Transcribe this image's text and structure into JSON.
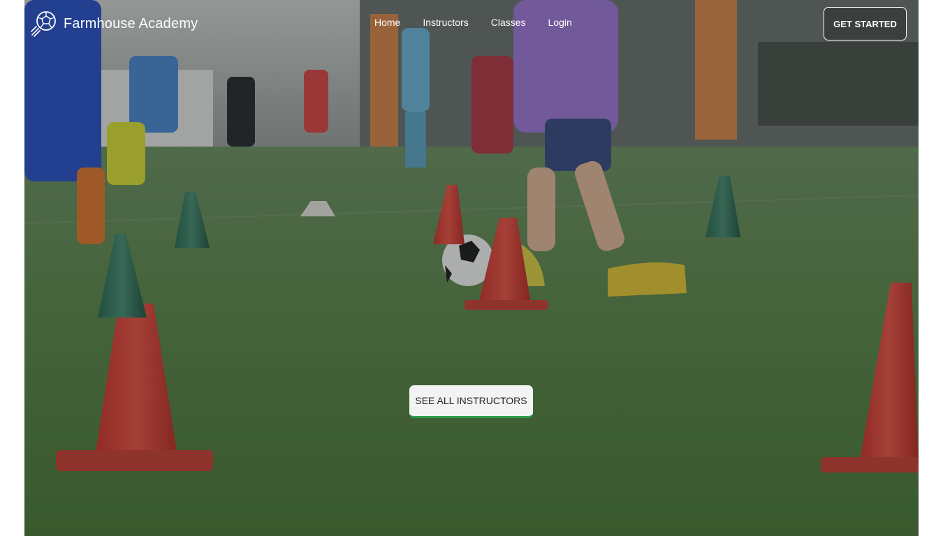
{
  "brand": {
    "name": "Farmhouse Academy",
    "icon": "soccer-ball-logo-icon"
  },
  "nav": {
    "links": [
      "Home",
      "Instructors",
      "Classes",
      "Login"
    ]
  },
  "header": {
    "cta_label": "GET STARTED"
  },
  "hero": {
    "button_label": "SEE ALL INSTRUCTORS",
    "button_accent": "#2e9e4f",
    "background": "photo of kids soccer training with cones and ball"
  }
}
